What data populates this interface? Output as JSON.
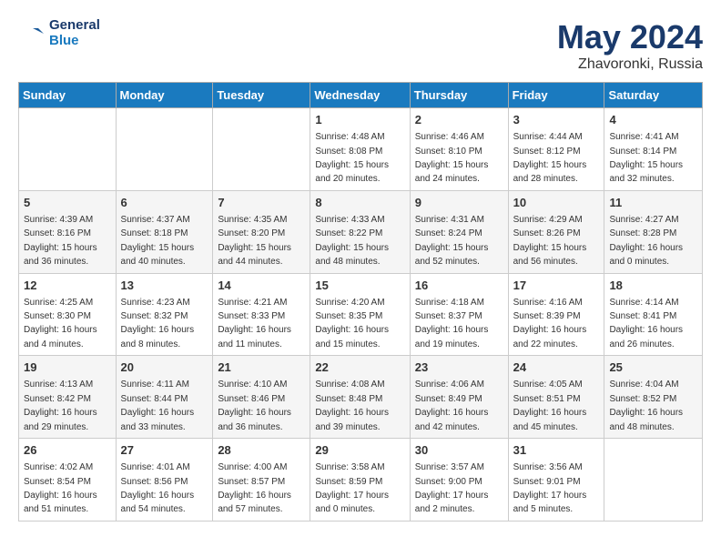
{
  "header": {
    "logo_line1": "General",
    "logo_line2": "Blue",
    "month": "May 2024",
    "location": "Zhavoronki, Russia"
  },
  "days_of_week": [
    "Sunday",
    "Monday",
    "Tuesday",
    "Wednesday",
    "Thursday",
    "Friday",
    "Saturday"
  ],
  "weeks": [
    [
      {
        "day": "",
        "info": ""
      },
      {
        "day": "",
        "info": ""
      },
      {
        "day": "",
        "info": ""
      },
      {
        "day": "1",
        "info": "Sunrise: 4:48 AM\nSunset: 8:08 PM\nDaylight: 15 hours\nand 20 minutes."
      },
      {
        "day": "2",
        "info": "Sunrise: 4:46 AM\nSunset: 8:10 PM\nDaylight: 15 hours\nand 24 minutes."
      },
      {
        "day": "3",
        "info": "Sunrise: 4:44 AM\nSunset: 8:12 PM\nDaylight: 15 hours\nand 28 minutes."
      },
      {
        "day": "4",
        "info": "Sunrise: 4:41 AM\nSunset: 8:14 PM\nDaylight: 15 hours\nand 32 minutes."
      }
    ],
    [
      {
        "day": "5",
        "info": "Sunrise: 4:39 AM\nSunset: 8:16 PM\nDaylight: 15 hours\nand 36 minutes."
      },
      {
        "day": "6",
        "info": "Sunrise: 4:37 AM\nSunset: 8:18 PM\nDaylight: 15 hours\nand 40 minutes."
      },
      {
        "day": "7",
        "info": "Sunrise: 4:35 AM\nSunset: 8:20 PM\nDaylight: 15 hours\nand 44 minutes."
      },
      {
        "day": "8",
        "info": "Sunrise: 4:33 AM\nSunset: 8:22 PM\nDaylight: 15 hours\nand 48 minutes."
      },
      {
        "day": "9",
        "info": "Sunrise: 4:31 AM\nSunset: 8:24 PM\nDaylight: 15 hours\nand 52 minutes."
      },
      {
        "day": "10",
        "info": "Sunrise: 4:29 AM\nSunset: 8:26 PM\nDaylight: 15 hours\nand 56 minutes."
      },
      {
        "day": "11",
        "info": "Sunrise: 4:27 AM\nSunset: 8:28 PM\nDaylight: 16 hours\nand 0 minutes."
      }
    ],
    [
      {
        "day": "12",
        "info": "Sunrise: 4:25 AM\nSunset: 8:30 PM\nDaylight: 16 hours\nand 4 minutes."
      },
      {
        "day": "13",
        "info": "Sunrise: 4:23 AM\nSunset: 8:32 PM\nDaylight: 16 hours\nand 8 minutes."
      },
      {
        "day": "14",
        "info": "Sunrise: 4:21 AM\nSunset: 8:33 PM\nDaylight: 16 hours\nand 11 minutes."
      },
      {
        "day": "15",
        "info": "Sunrise: 4:20 AM\nSunset: 8:35 PM\nDaylight: 16 hours\nand 15 minutes."
      },
      {
        "day": "16",
        "info": "Sunrise: 4:18 AM\nSunset: 8:37 PM\nDaylight: 16 hours\nand 19 minutes."
      },
      {
        "day": "17",
        "info": "Sunrise: 4:16 AM\nSunset: 8:39 PM\nDaylight: 16 hours\nand 22 minutes."
      },
      {
        "day": "18",
        "info": "Sunrise: 4:14 AM\nSunset: 8:41 PM\nDaylight: 16 hours\nand 26 minutes."
      }
    ],
    [
      {
        "day": "19",
        "info": "Sunrise: 4:13 AM\nSunset: 8:42 PM\nDaylight: 16 hours\nand 29 minutes."
      },
      {
        "day": "20",
        "info": "Sunrise: 4:11 AM\nSunset: 8:44 PM\nDaylight: 16 hours\nand 33 minutes."
      },
      {
        "day": "21",
        "info": "Sunrise: 4:10 AM\nSunset: 8:46 PM\nDaylight: 16 hours\nand 36 minutes."
      },
      {
        "day": "22",
        "info": "Sunrise: 4:08 AM\nSunset: 8:48 PM\nDaylight: 16 hours\nand 39 minutes."
      },
      {
        "day": "23",
        "info": "Sunrise: 4:06 AM\nSunset: 8:49 PM\nDaylight: 16 hours\nand 42 minutes."
      },
      {
        "day": "24",
        "info": "Sunrise: 4:05 AM\nSunset: 8:51 PM\nDaylight: 16 hours\nand 45 minutes."
      },
      {
        "day": "25",
        "info": "Sunrise: 4:04 AM\nSunset: 8:52 PM\nDaylight: 16 hours\nand 48 minutes."
      }
    ],
    [
      {
        "day": "26",
        "info": "Sunrise: 4:02 AM\nSunset: 8:54 PM\nDaylight: 16 hours\nand 51 minutes."
      },
      {
        "day": "27",
        "info": "Sunrise: 4:01 AM\nSunset: 8:56 PM\nDaylight: 16 hours\nand 54 minutes."
      },
      {
        "day": "28",
        "info": "Sunrise: 4:00 AM\nSunset: 8:57 PM\nDaylight: 16 hours\nand 57 minutes."
      },
      {
        "day": "29",
        "info": "Sunrise: 3:58 AM\nSunset: 8:59 PM\nDaylight: 17 hours\nand 0 minutes."
      },
      {
        "day": "30",
        "info": "Sunrise: 3:57 AM\nSunset: 9:00 PM\nDaylight: 17 hours\nand 2 minutes."
      },
      {
        "day": "31",
        "info": "Sunrise: 3:56 AM\nSunset: 9:01 PM\nDaylight: 17 hours\nand 5 minutes."
      },
      {
        "day": "",
        "info": ""
      }
    ]
  ]
}
